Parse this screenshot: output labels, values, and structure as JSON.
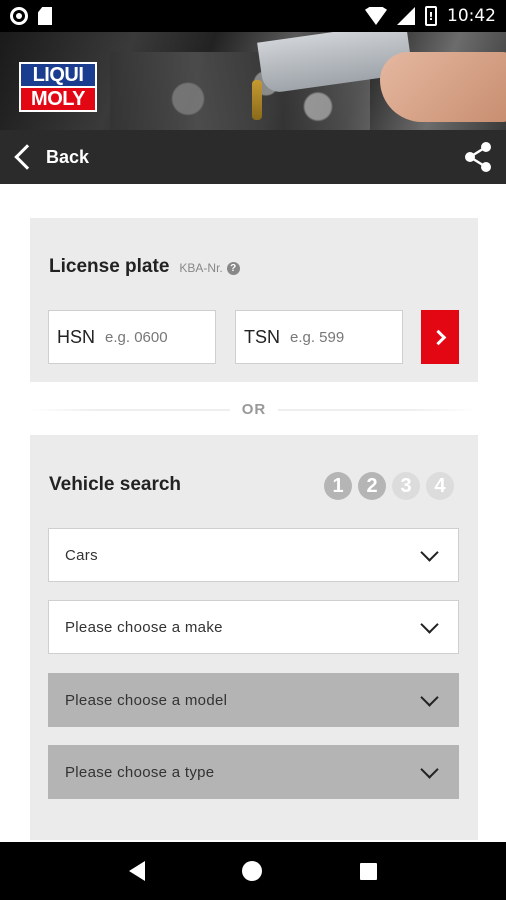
{
  "status_bar": {
    "time": "10:42",
    "battery_glyph": "!"
  },
  "brand": {
    "logo_line1": "LIQUI",
    "logo_line2": "MOLY",
    "colors": {
      "blue": "#1a3d8f",
      "red": "#e30613"
    }
  },
  "nav": {
    "back_label": "Back",
    "share_icon": "share-icon"
  },
  "license_plate": {
    "title": "License plate",
    "kba_label": "KBA-Nr.",
    "help_glyph": "?",
    "hsn_label": "HSN",
    "hsn_placeholder": "e.g. 0600",
    "tsn_label": "TSN",
    "tsn_placeholder": "e.g. 599"
  },
  "divider": {
    "text": "OR"
  },
  "vehicle_search": {
    "title": "Vehicle search",
    "steps": [
      "1",
      "2",
      "3",
      "4"
    ],
    "selects": [
      {
        "text": "Cars",
        "state": "active"
      },
      {
        "text": "Please choose a make",
        "state": "active"
      },
      {
        "text": "Please choose a model",
        "state": "disabled"
      },
      {
        "text": "Please choose a type",
        "state": "disabled"
      }
    ]
  }
}
